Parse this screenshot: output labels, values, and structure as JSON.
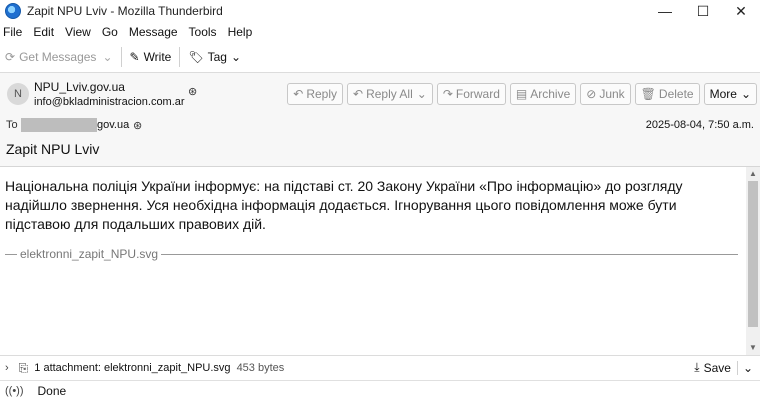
{
  "window": {
    "title": "Zapit NPU Lviv - Mozilla Thunderbird",
    "minimize": "—",
    "maximize": "☐",
    "close": "✕"
  },
  "menu": [
    "File",
    "Edit",
    "View",
    "Go",
    "Message",
    "Tools",
    "Help"
  ],
  "toolbar": {
    "get_messages": "Get Messages",
    "write": "Write",
    "tag": "Tag"
  },
  "header": {
    "avatar_initial": "N",
    "sender_name": "NPU_Lviv.gov.ua",
    "sender_email": "info@bkladministracion.com.ar",
    "actions": [
      "Reply",
      "Reply All",
      "Forward",
      "Archive",
      "Junk",
      "Delete",
      "More"
    ],
    "to_label": "To",
    "to_domain": "gov.ua",
    "date": "2025-08-04, 7:50 a.m.",
    "subject": "Zapit NPU Lviv"
  },
  "message": {
    "body": "Національна поліція України інформує: на підставі ст. 20 Закону України «Про інформацію» до розгляду надійшло звернення. Уся необхідна інформація додається. Ігнорування цього повідомлення може бути підставою для подальших правових дій.",
    "signature_attachment": "elektronni_zapit_NPU.svg"
  },
  "attachment_bar": {
    "summary": "1 attachment: elektronni_zapit_NPU.svg",
    "size": "453 bytes",
    "save_label": "Save"
  },
  "status": {
    "text": "Done"
  },
  "icons": {
    "app": "thunderbird-icon",
    "get_messages": "download-icon",
    "write": "pencil-icon",
    "tag": "tag-icon"
  }
}
